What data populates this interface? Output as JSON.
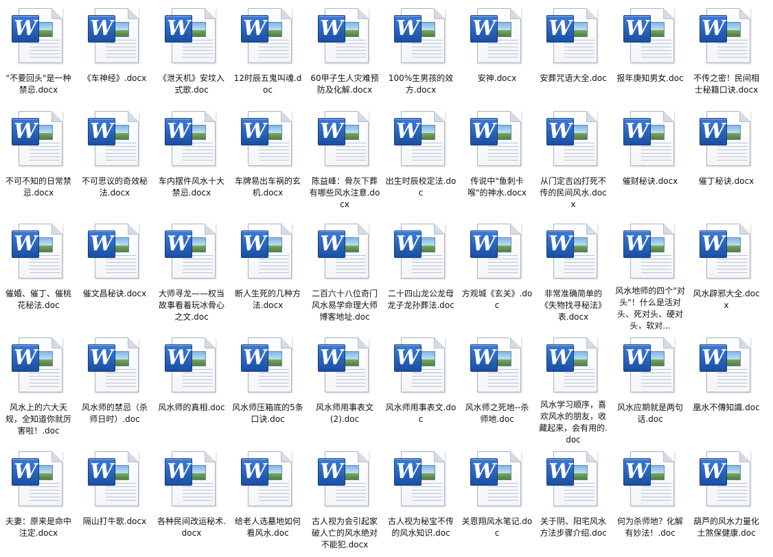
{
  "files": [
    {
      "name": "\"不要回头\"是一种禁忌.docx"
    },
    {
      "name": "《车神经》.docx"
    },
    {
      "name": "《泄天机》安坟入式歌.doc"
    },
    {
      "name": "12时辰五鬼叫魂.doc"
    },
    {
      "name": "60甲子生人灾难预防及化解.docx"
    },
    {
      "name": "100%生男孩的效方.docx"
    },
    {
      "name": "安神.docx"
    },
    {
      "name": "安葬咒语大全.doc"
    },
    {
      "name": "报年庚知男女.doc"
    },
    {
      "name": "不传之密！民间相士秘籍口诀.docx"
    },
    {
      "name": "不可不知的日常禁忌.docx"
    },
    {
      "name": "不可思议的奇效秘法.docx"
    },
    {
      "name": "车内摆件风水十大禁忌.docx"
    },
    {
      "name": "车牌易出车祸的玄机.docx"
    },
    {
      "name": "陈益峰：骨灰下葬有哪些风水注意.docx"
    },
    {
      "name": "出生时辰校定法.doc"
    },
    {
      "name": "传说中\"鱼刺卡喉\"的神水.docx"
    },
    {
      "name": "从门定吉凶打死不传的民间风水.docx"
    },
    {
      "name": "催财秘诀.docx"
    },
    {
      "name": "催丁秘诀.docx"
    },
    {
      "name": "催婚、催丁、催桃花秘法.doc"
    },
    {
      "name": "催文昌秘诀.docx"
    },
    {
      "name": "大师寻龙——权当故事看着玩冰骨心之文.doc"
    },
    {
      "name": "断人生死的几种方法.docx"
    },
    {
      "name": "二百六十八位奇门风水易学命理大师博客地址.doc"
    },
    {
      "name": "二十四山龙公龙母龙子龙孙葬法.doc"
    },
    {
      "name": "方观城《玄关》.doc"
    },
    {
      "name": "非常准确简单的《失物找寻秘法》表.docx"
    },
    {
      "name": "风水地师的四个\"对头\"！什么是活对头、死对头、硬对头，软对..."
    },
    {
      "name": "风水辟邪大全.docx"
    },
    {
      "name": "风水上的六大天规，全知道你就厉害啦！.doc"
    },
    {
      "name": "风水师的禁忌（杀师日时）.doc"
    },
    {
      "name": "风水师的真相.doc"
    },
    {
      "name": "风水师压箱底的5条口诀.doc"
    },
    {
      "name": "风水师用事表文(2).doc"
    },
    {
      "name": "风水师用事表文.doc"
    },
    {
      "name": "风水师之死地--杀师地.doc"
    },
    {
      "name": "风水学习顺序，喜欢风水的朋友，收藏起来，会有用的.doc"
    },
    {
      "name": "风水应期就是两句话.doc"
    },
    {
      "name": "凰水不傳知識.doc"
    },
    {
      "name": "夫妻：原来是命中注定.docx"
    },
    {
      "name": "隔山打牛歌.docx"
    },
    {
      "name": "各种民间改运秘术.docx"
    },
    {
      "name": "给老人选墓地如何看风水.doc"
    },
    {
      "name": "古人视为会引起家破人亡的风水绝对不能犯.docx"
    },
    {
      "name": "古人视为秘宝不传的风水知识.doc"
    },
    {
      "name": "关恩翔风水笔记.doc"
    },
    {
      "name": "关于阴、阳宅风水方法步骤介绍.doc"
    },
    {
      "name": "何为杀师地？化解有妙法！.doc"
    },
    {
      "name": "葫芦的风水力量化土煞保健康.doc"
    }
  ],
  "icon": {
    "glyph": "W",
    "type": "word-document-icon"
  }
}
